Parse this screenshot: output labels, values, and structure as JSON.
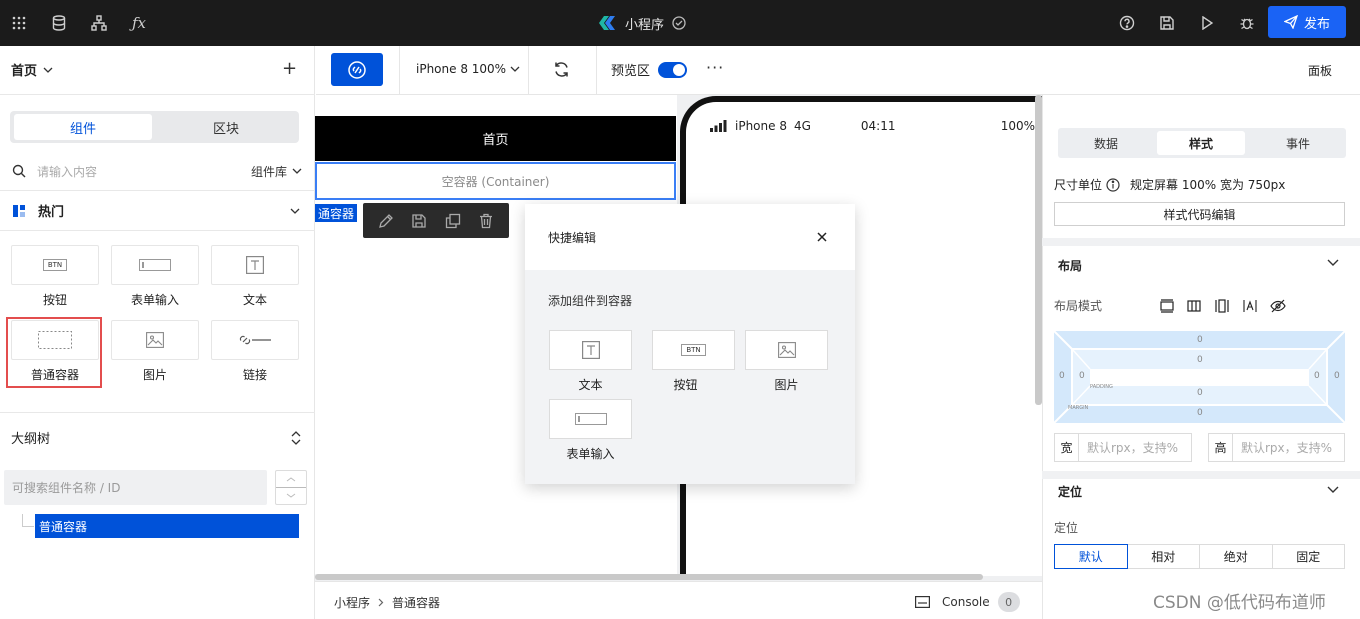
{
  "topbar": {
    "app_title": "小程序",
    "publish_label": "发布",
    "icons": [
      "grid-icon",
      "database-icon",
      "hierarchy-icon",
      "function-icon",
      "help-icon",
      "save-icon",
      "play-icon",
      "debug-icon",
      "send-icon"
    ],
    "accent": "#1a63f5"
  },
  "left": {
    "page_selector": "首页",
    "tabs": {
      "components": "组件",
      "blocks": "区块"
    },
    "search_placeholder": "请输入内容",
    "library_label": "组件库",
    "hot_label": "热门",
    "components": [
      {
        "label": "按钮",
        "icon": "BTN"
      },
      {
        "label": "表单输入",
        "icon": "input-icon"
      },
      {
        "label": "文本",
        "icon": "text-icon"
      },
      {
        "label": "普通容器",
        "icon": "container-icon"
      },
      {
        "label": "图片",
        "icon": "image-icon"
      },
      {
        "label": "链接",
        "icon": "link-icon"
      }
    ],
    "outline_label": "大纲树",
    "outline_search_placeholder": "可搜索组件名称 / ID",
    "tree_selected": "普通容器"
  },
  "toolbar": {
    "device": "iPhone 8 100%",
    "preview_label": "预览区",
    "panel_label": "面板"
  },
  "canvas": {
    "page_title": "首页",
    "container_text": "空容器 (Container)",
    "component_tag": "通容器",
    "phone_status": {
      "carrier": "iPhone 8",
      "network": "4G",
      "time": "04:11",
      "battery": "100%"
    }
  },
  "quick_edit": {
    "title": "快捷编辑",
    "subtitle": "添加组件到容器",
    "items": [
      {
        "label": "文本",
        "icon": "text-icon"
      },
      {
        "label": "按钮",
        "icon": "BTN"
      },
      {
        "label": "图片",
        "icon": "image-icon"
      },
      {
        "label": "表单输入",
        "icon": "input-icon"
      }
    ]
  },
  "bottombar": {
    "crumbs": [
      "小程序",
      "普通容器"
    ],
    "console_label": "Console",
    "console_count": "0"
  },
  "right": {
    "tabs": [
      "数据",
      "样式",
      "事件"
    ],
    "active_tab": "样式",
    "unit_label": "尺寸单位",
    "unit_value": "规定屏幕 100% 宽为 750px",
    "code_btn": "样式代码编辑",
    "layout_section": "布局",
    "layout_mode_label": "布局模式",
    "box_model": {
      "margin": [
        "0",
        "0",
        "0",
        "0"
      ],
      "padding": [
        "0",
        "0",
        "0",
        "0"
      ],
      "padding_label": "PADDING",
      "margin_label": "MARGIN"
    },
    "width_label": "宽",
    "width_placeholder": "默认rpx，支持%",
    "height_label": "高",
    "height_placeholder": "默认rpx，支持%",
    "position_section": "定位",
    "position_label": "定位",
    "position_options": [
      "默认",
      "相对",
      "绝对",
      "固定"
    ],
    "position_selected": "默认"
  },
  "watermark": "CSDN @低代码布道师"
}
